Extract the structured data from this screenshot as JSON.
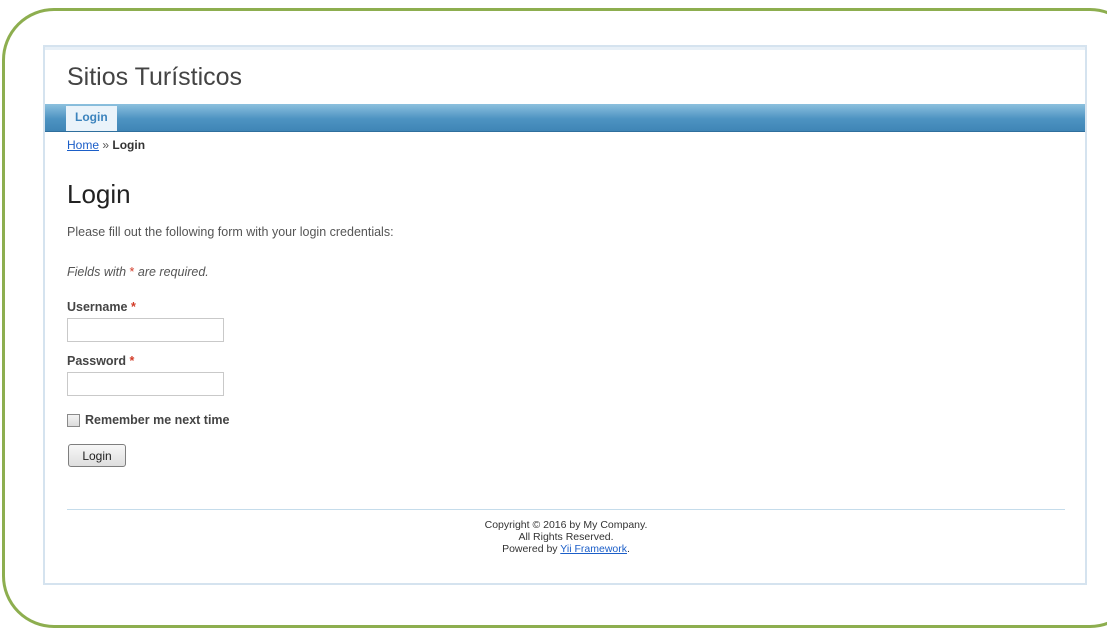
{
  "header": {
    "title": "Sitios Turísticos"
  },
  "mainmenu": {
    "items": [
      {
        "label": "Login",
        "active": true
      }
    ]
  },
  "breadcrumb": {
    "home": "Home",
    "separator": "»",
    "current": "Login"
  },
  "page": {
    "title": "Login",
    "intro": "Please fill out the following form with your login credentials:",
    "required_note_prefix": "Fields with",
    "required_marker": "*",
    "required_note_suffix": "are required."
  },
  "form": {
    "username": {
      "label": "Username",
      "value": "",
      "placeholder": ""
    },
    "password": {
      "label": "Password",
      "value": "",
      "placeholder": ""
    },
    "remember": {
      "label": "Remember me next time",
      "checked": false
    },
    "submit_label": "Login"
  },
  "footer": {
    "line1": "Copyright © 2016 by My Company.",
    "line2": "All Rights Reserved.",
    "powered_prefix": "Powered by",
    "powered_link": "Yii Framework",
    "powered_suffix": "."
  },
  "colors": {
    "frame_border": "#8dae4f",
    "menu_bar": "#4d93c2",
    "link": "#1b5ec8",
    "required": "#d23b27"
  }
}
